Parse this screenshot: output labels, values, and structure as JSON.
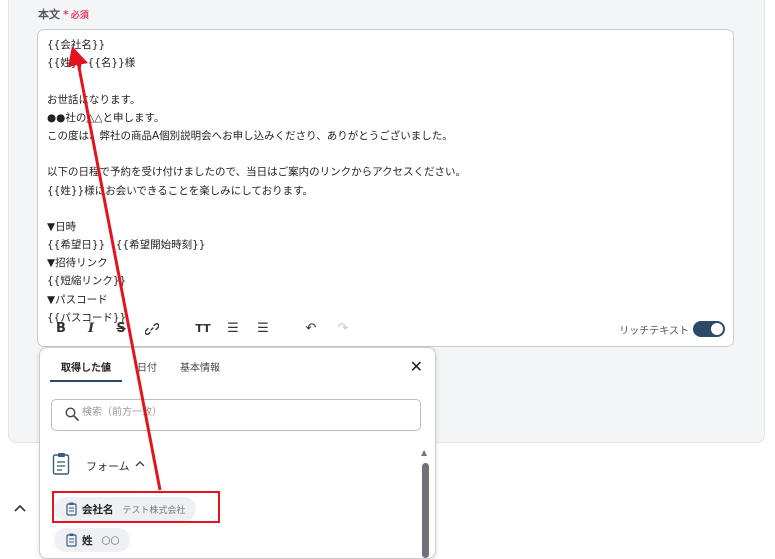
{
  "field": {
    "label": "本文",
    "required_star": "*",
    "required_text": "必須"
  },
  "editor": {
    "lines": [
      "{{会社名}}",
      "{{姓}} {{名}}様",
      "",
      "お世話になります。",
      "●●社の△△と申します。",
      "この度は、弊社の商品A個別説明会へお申し込みくださり、ありがとうございました。",
      "",
      "以下の日程で予約を受け付けましたので、当日はご案内のリンクからアクセスください。",
      "{{姓}}様にお会いできることを楽しみにしております。",
      "",
      "▼日時",
      "{{希望日}}　{{希望開始時刻}}",
      "▼招待リンク",
      "{{短縮リンク}}",
      "▼パスコード",
      "{{パスコード}}"
    ],
    "toolbar": {
      "bold": "B",
      "italic": "I",
      "strike": "S",
      "link": "⚲",
      "text_size": "TT",
      "bullet_list": "☰",
      "numbered_list": "☰",
      "undo": "↶",
      "redo": "↷",
      "rich_text_label": "リッチテキスト",
      "rich_text_on": true
    }
  },
  "popup": {
    "tabs": [
      "取得した値",
      "日付",
      "基本情報"
    ],
    "active_tab": 0,
    "close": "✕",
    "search_placeholder": "検索（前方一致）",
    "group_label": "フォーム",
    "group_chevron": "^",
    "items": [
      {
        "name": "会社名",
        "value": "テスト株式会社"
      },
      {
        "name": "姓",
        "value": "〇〇"
      }
    ]
  },
  "colors": {
    "accent": "#2b4a6b",
    "highlight": "#e3141e",
    "required": "#e0416a"
  },
  "icons": [
    "search-icon",
    "close-icon",
    "form-icon",
    "chevron-up-icon",
    "undo-icon",
    "redo-icon",
    "link-icon"
  ]
}
